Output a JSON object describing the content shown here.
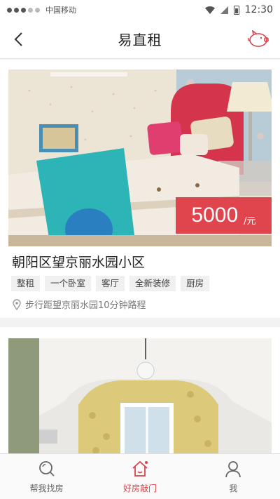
{
  "status_bar": {
    "carrier": "中国移动",
    "time": "12:30"
  },
  "nav": {
    "title": "易直租"
  },
  "listings": [
    {
      "price": "5000",
      "price_unit": "/元",
      "title": "朝阳区望京丽水园小区",
      "tags": [
        "整租",
        "一个卧室",
        "客厅",
        "全新装修",
        "厨房"
      ],
      "location": "步行距望京丽水园10分钟路程"
    },
    {
      "title": ""
    }
  ],
  "tabs": [
    {
      "label": "帮我找房",
      "icon": "search-icon"
    },
    {
      "label": "好房敲门",
      "icon": "home-icon"
    },
    {
      "label": "我",
      "icon": "person-icon"
    }
  ],
  "colors": {
    "accent": "#e0444d",
    "active_tab": "#d9434b"
  }
}
